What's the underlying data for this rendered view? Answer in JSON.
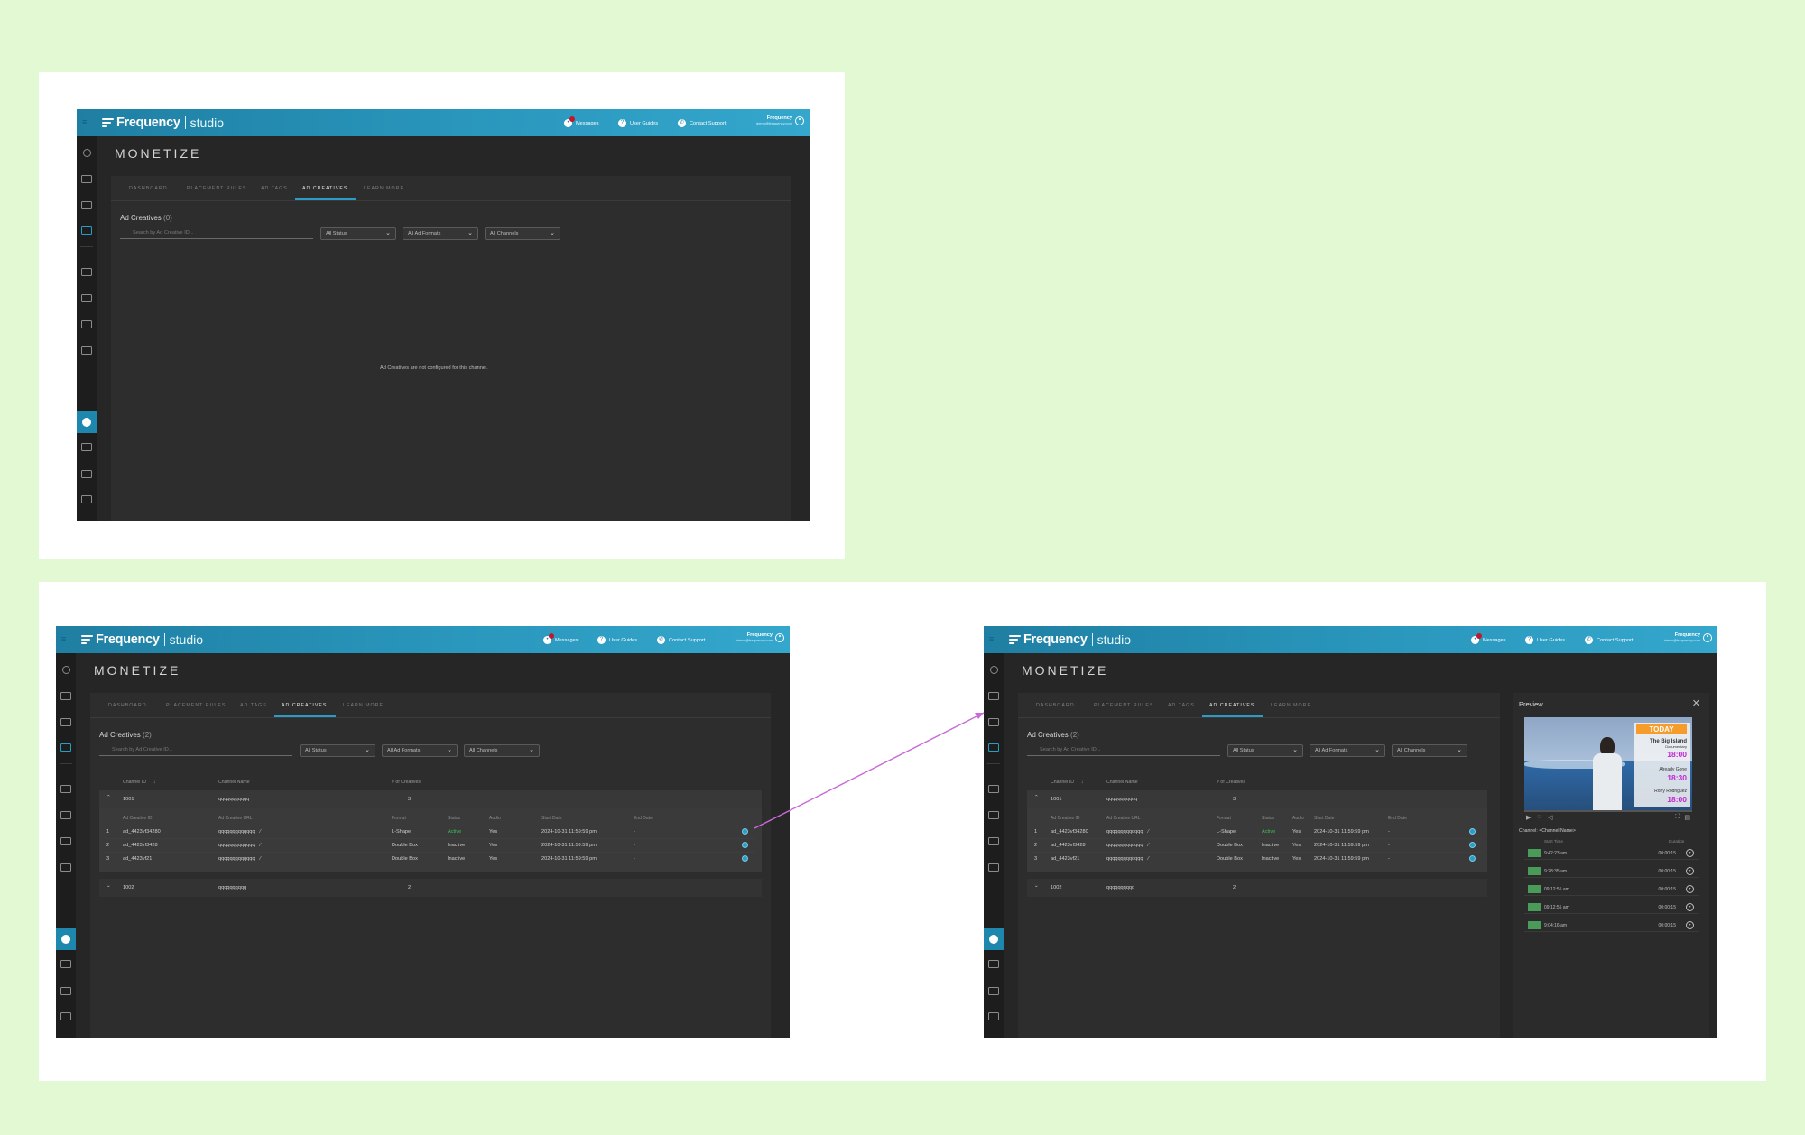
{
  "header": {
    "brand": "Frequency",
    "product": "studio",
    "messages_label": "Messages",
    "guides_label": "User Guides",
    "support_label": "Contact Support",
    "user_name": "Frequency",
    "user_email": "demo@frequency.com"
  },
  "page": {
    "title": "MONETIZE",
    "tabs": [
      "DASHBOARD",
      "PLACEMENT RULES",
      "AD TAGS",
      "AD CREATIVES",
      "LEARN MORE"
    ],
    "section_title": "Ad Creatives",
    "search_placeholder": "Search by Ad Creative ID...",
    "filters": [
      "All Status",
      "All Ad Formats",
      "All Channels"
    ]
  },
  "screen_empty": {
    "count": "(0)",
    "empty_message": "Ad Creatives are not configured for this channel."
  },
  "screen_list": {
    "count": "(2)",
    "columns": [
      "Channel ID",
      "Channel Name",
      "# of Creatives"
    ],
    "sub_columns": [
      "Ad Creative ID",
      "Ad Creative URL",
      "Format",
      "Status",
      "Audio",
      "Start Date",
      "End Date"
    ],
    "groups": [
      {
        "id": "1001",
        "name": "qqqqqqqqqqq",
        "count": "3"
      },
      {
        "id": "1002",
        "name": "qqqqqqqqqq",
        "count": "2"
      }
    ],
    "creatives": [
      {
        "n": "1",
        "id": "ad_4423vf34280",
        "url": "qqqqqqqqqqqqq",
        "format": "L-Shape",
        "status": "Active",
        "audio": "Yes",
        "start": "2024-10-31 11:59:59 pm",
        "end": "-"
      },
      {
        "n": "2",
        "id": "ad_4423vf3428",
        "url": "qqqqqqqqqqqqq",
        "format": "Double Box",
        "status": "Inactive",
        "audio": "Yes",
        "start": "2024-10-31 11:59:59 pm",
        "end": "-"
      },
      {
        "n": "3",
        "id": "ad_4423vf21",
        "url": "qqqqqqqqqqqqq",
        "format": "Double Box",
        "status": "Inactive",
        "audio": "Yes",
        "start": "2024-10-31 11:59:59 pm",
        "end": "-"
      }
    ]
  },
  "preview": {
    "title": "Preview",
    "channel_label": "Channel: <Channel Name>",
    "overlay": {
      "badge": "TODAY",
      "show1": "The Big Island",
      "show1_sub": "Documentary",
      "time1": "18:00",
      "show2": "Already Gone",
      "time2": "18:30",
      "show3": "Rony Rodriguez",
      "time3": "18:00"
    },
    "columns": [
      "Start Time",
      "Duration"
    ],
    "items": [
      {
        "time": "9:42:23 am",
        "duration": "00:00:15"
      },
      {
        "time": "9:28:35 am",
        "duration": "00:00:15"
      },
      {
        "time": "09:12:55 am",
        "duration": "00:00:15"
      },
      {
        "time": "09:12:55 am",
        "duration": "00:00:15"
      },
      {
        "time": "9:04:16 am",
        "duration": "00:00:15"
      }
    ]
  },
  "colors": {
    "background": "#e2f9d3",
    "header_blue": "#2a97bd",
    "accent": "#2a9dc5",
    "active_status": "#3fbf5c",
    "arrow": "#c86bd8"
  }
}
